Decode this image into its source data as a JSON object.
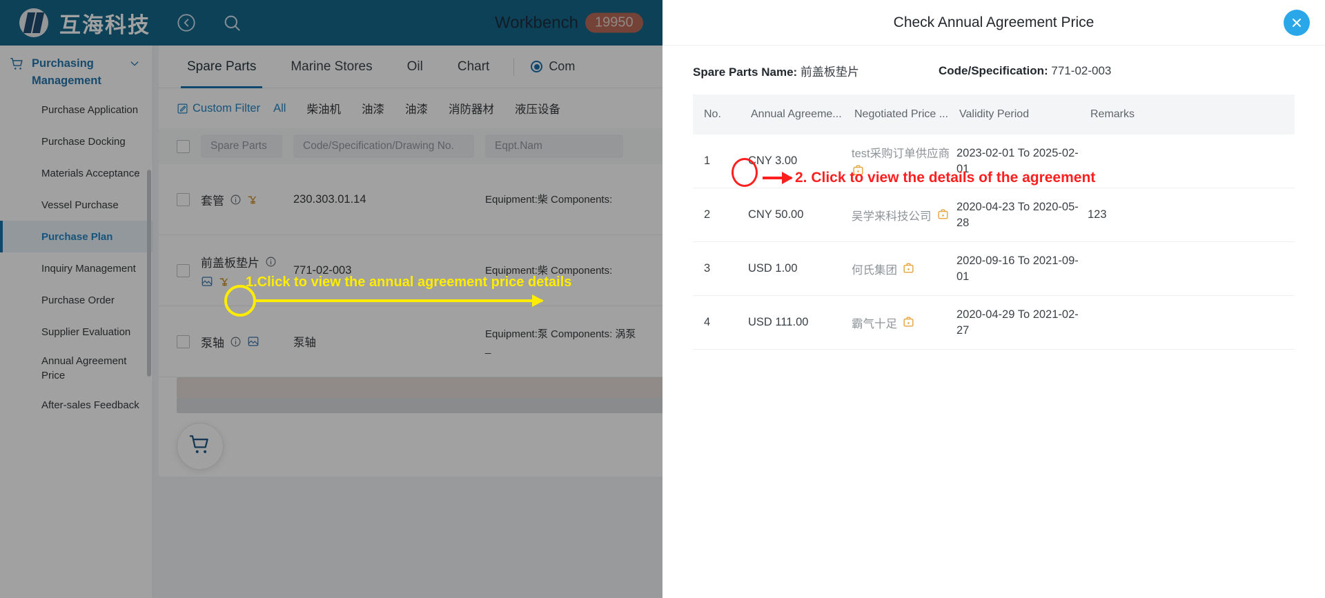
{
  "topbar": {
    "brand": "互海科技",
    "back_icon": "back-arrow-icon",
    "search_icon": "search-icon",
    "workbench_label": "Workbench",
    "workbench_count": "19950"
  },
  "sidebar": {
    "group_title": "Purchasing Management",
    "group_icon": "cart-icon",
    "chevron_icon": "chevron-down-icon",
    "items": [
      {
        "label": "Purchase Application",
        "active": false,
        "submenu": false
      },
      {
        "label": "Purchase Docking",
        "active": false,
        "submenu": false
      },
      {
        "label": "Materials Acceptance",
        "active": false,
        "submenu": true
      },
      {
        "label": "Vessel Purchase",
        "active": false,
        "submenu": false
      },
      {
        "label": "Purchase Plan",
        "active": true,
        "submenu": false
      },
      {
        "label": "Inquiry Management",
        "active": false,
        "submenu": false
      },
      {
        "label": "Purchase Order",
        "active": false,
        "submenu": false
      },
      {
        "label": "Supplier Evaluation",
        "active": false,
        "submenu": false
      },
      {
        "label": "Annual Agreement Price",
        "active": false,
        "submenu": false
      },
      {
        "label": "After-sales Feedback",
        "active": false,
        "submenu": false
      }
    ]
  },
  "content": {
    "tabs": [
      {
        "label": "Spare Parts",
        "active": true
      },
      {
        "label": "Marine Stores",
        "active": false
      },
      {
        "label": "Oil",
        "active": false
      },
      {
        "label": "Chart",
        "active": false
      }
    ],
    "radio_label": "Com",
    "filters": {
      "custom_filter_label": "Custom Filter",
      "custom_filter_icon": "edit-square-icon",
      "chips": [
        "All",
        "柴油机",
        "油漆",
        "油漆",
        "消防器材",
        "液压设备"
      ],
      "selected_chip": "All"
    },
    "search_fields": [
      {
        "placeholder": "Spare Parts"
      },
      {
        "placeholder": "Code/Specification/Drawing No."
      },
      {
        "placeholder": "Eqpt.Nam"
      }
    ],
    "rows": [
      {
        "name": "套管",
        "icons": [
          "info-circle-icon",
          "yen-price-icon"
        ],
        "code": "230.303.01.14",
        "equipment": "Equipment:柴 Components:"
      },
      {
        "name": "前盖板垫片",
        "icons": [
          "info-circle-icon",
          "image-icon",
          "yen-price-icon"
        ],
        "code": "771-02-003",
        "equipment": "Equipment:柴 Components:"
      },
      {
        "name": "泵轴",
        "icons": [
          "info-circle-icon",
          "image-icon"
        ],
        "code": "泵轴",
        "equipment": "Equipment:泵 Components: 涡泵_"
      }
    ],
    "fab_icon": "shopping-cart-icon"
  },
  "modal": {
    "title": "Check Annual Agreement Price",
    "close_icon": "close-icon",
    "spare_parts_name_label": "Spare Parts Name:",
    "spare_parts_name_value": "前盖板垫片",
    "code_label": "Code/Specification:",
    "code_value": "771-02-003",
    "columns": [
      "No.",
      "Annual Agreeme...",
      "Negotiated Price ...",
      "Validity Period",
      "Remarks"
    ],
    "rows": [
      {
        "no": "1",
        "amount": "CNY 3.00",
        "supplier": "test采购订单供应商",
        "supplier_icon": "briefcase-icon",
        "validity": "2023-02-01 To 2025-02-01",
        "remarks": ""
      },
      {
        "no": "2",
        "amount": "CNY 50.00",
        "supplier": "吴学来科技公司",
        "supplier_icon": "briefcase-icon",
        "validity": "2020-04-23 To 2020-05-28",
        "remarks": "123"
      },
      {
        "no": "3",
        "amount": "USD 1.00",
        "supplier": "何氏集团",
        "supplier_icon": "briefcase-icon",
        "validity": "2020-09-16 To 2021-09-01",
        "remarks": ""
      },
      {
        "no": "4",
        "amount": "USD 111.00",
        "supplier": "霸气十足",
        "supplier_icon": "briefcase-icon",
        "validity": "2020-04-29 To 2021-02-27",
        "remarks": ""
      }
    ]
  },
  "annotations": {
    "step1_text": "1.Click to view the annual agreement price details",
    "step1_color": "#ffec00",
    "step2_text": "2. Click to view the details of the agreement",
    "step2_color": "#ff1f1f"
  }
}
